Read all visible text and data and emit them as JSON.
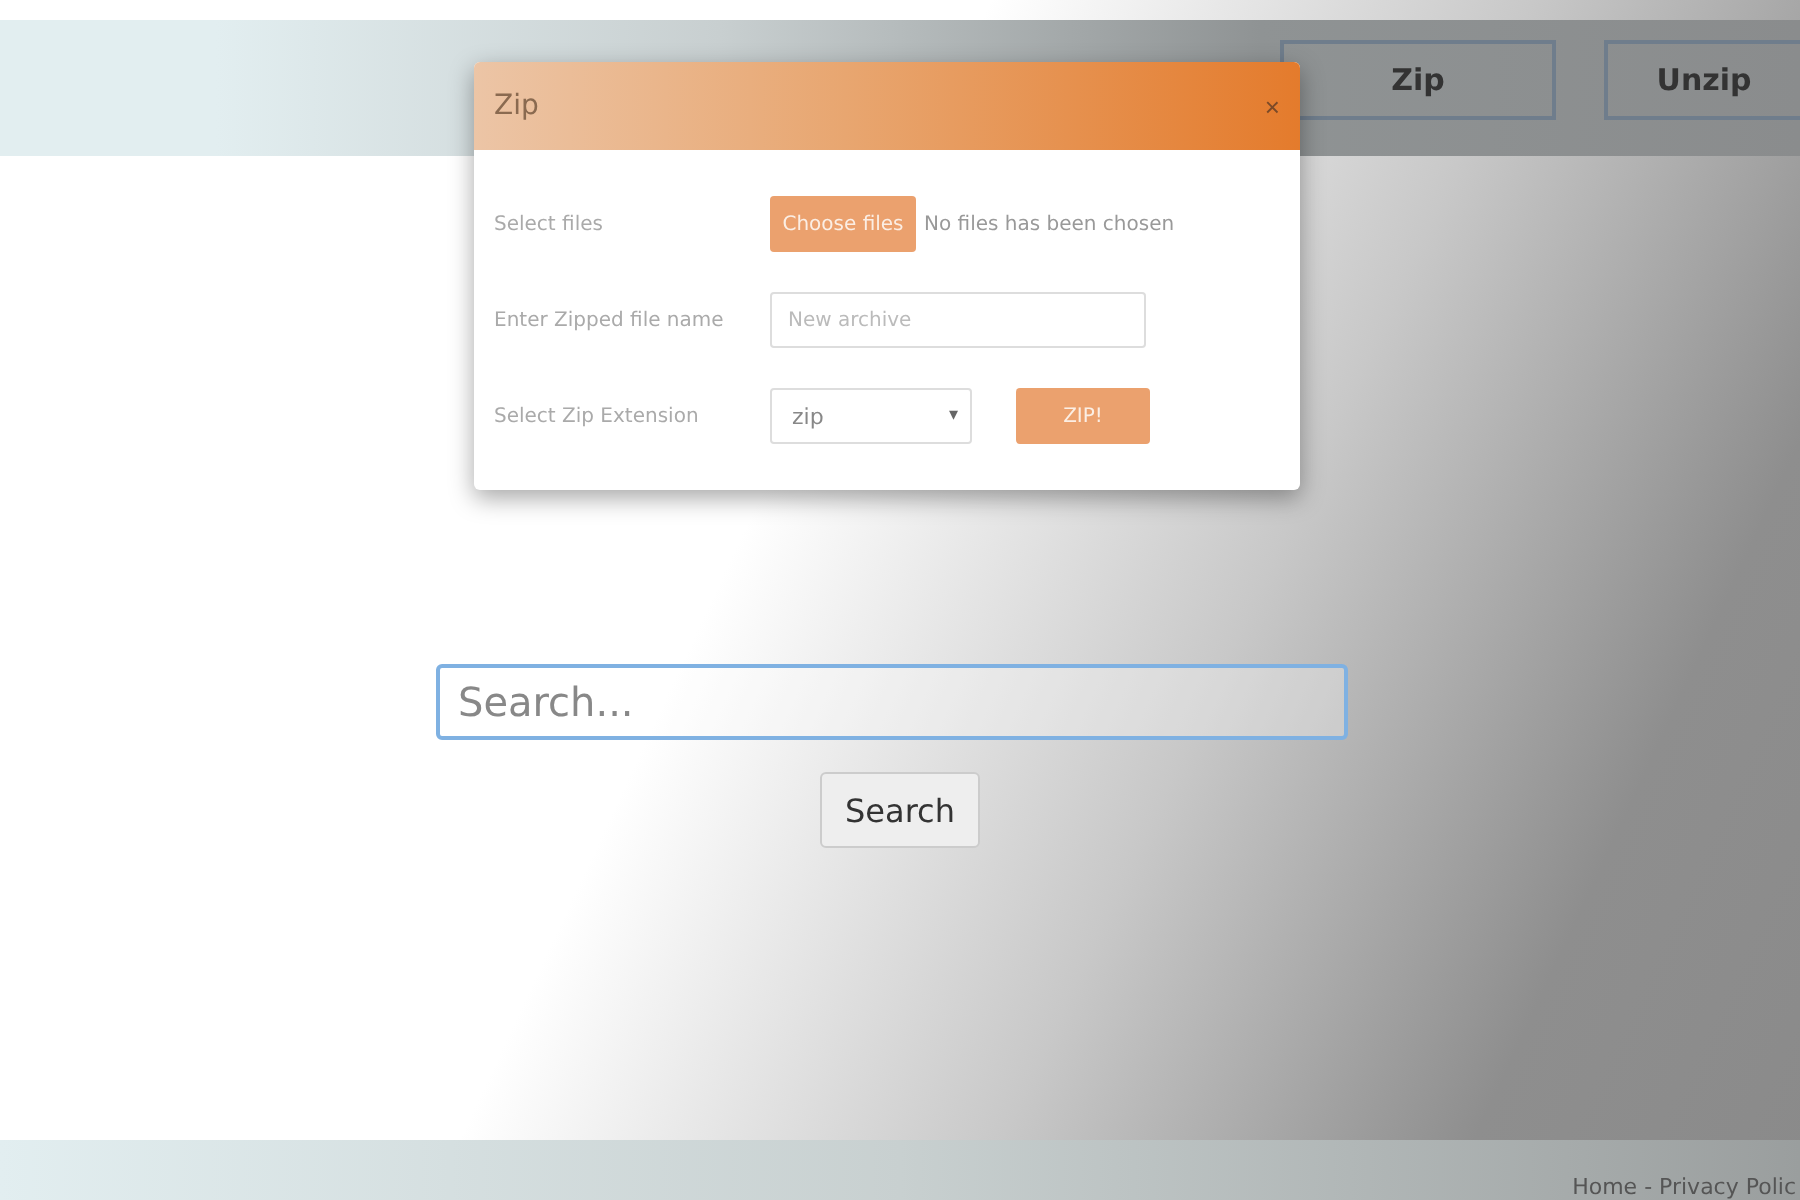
{
  "header": {
    "buttons": [
      "Zip",
      "Unzip"
    ]
  },
  "dialog": {
    "title": "Zip",
    "close": "×",
    "rows": [
      {
        "kind": "file",
        "label": "Select files",
        "button": "Choose files",
        "status": "No files has been chosen"
      },
      {
        "kind": "text",
        "label": "Enter Zipped file name",
        "placeholder": "New archive"
      },
      {
        "kind": "select",
        "label": "Select Zip Extension",
        "value": "zip",
        "arrow": "▾",
        "button": "ZIP!"
      }
    ]
  },
  "search": {
    "placeholder": "Search...",
    "button": "Search"
  },
  "footer": {
    "links": "Home - Privacy Polic"
  }
}
